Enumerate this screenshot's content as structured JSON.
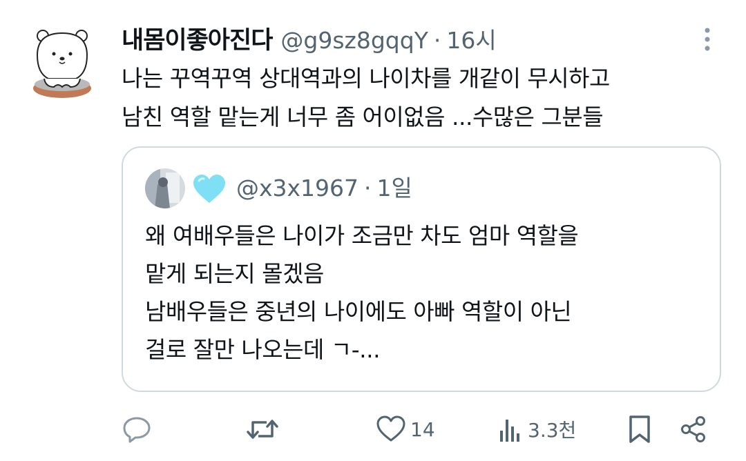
{
  "tweet": {
    "display_name": "내몸이좋아진다",
    "handle": "@g9sz8gqqY",
    "separator": "·",
    "time": "16시",
    "text_lines": [
      "나는 꾸역꾸역 상대역과의 나이차를 개같이 무시하고",
      "남친 역할 맡는게 너무 좀 어이없음 ...수많은 그분들"
    ]
  },
  "quote": {
    "heart_emoji": "light-blue-heart",
    "handle": "@x3x1967",
    "separator": "·",
    "time": "1일",
    "text_lines": [
      "왜 여배우들은 나이가 조금만 차도 엄마 역할을",
      "맡게 되는지 몰겠음",
      "남배우들은 중년의 나이에도 아빠 역할이 아닌",
      "걸로 잘만 나오는데 ㄱ-..."
    ]
  },
  "actions": {
    "reply_icon": "reply-icon",
    "retweet_icon": "retweet-icon",
    "like_icon": "heart-icon",
    "like_count": "14",
    "views_icon": "views-icon",
    "view_count": "3.3천",
    "bookmark_icon": "bookmark-icon",
    "share_icon": "share-icon"
  },
  "colors": {
    "text": "#0f1419",
    "secondary": "#536471",
    "border": "#cfd9de",
    "heart_emoji": "#7fe0f5"
  }
}
